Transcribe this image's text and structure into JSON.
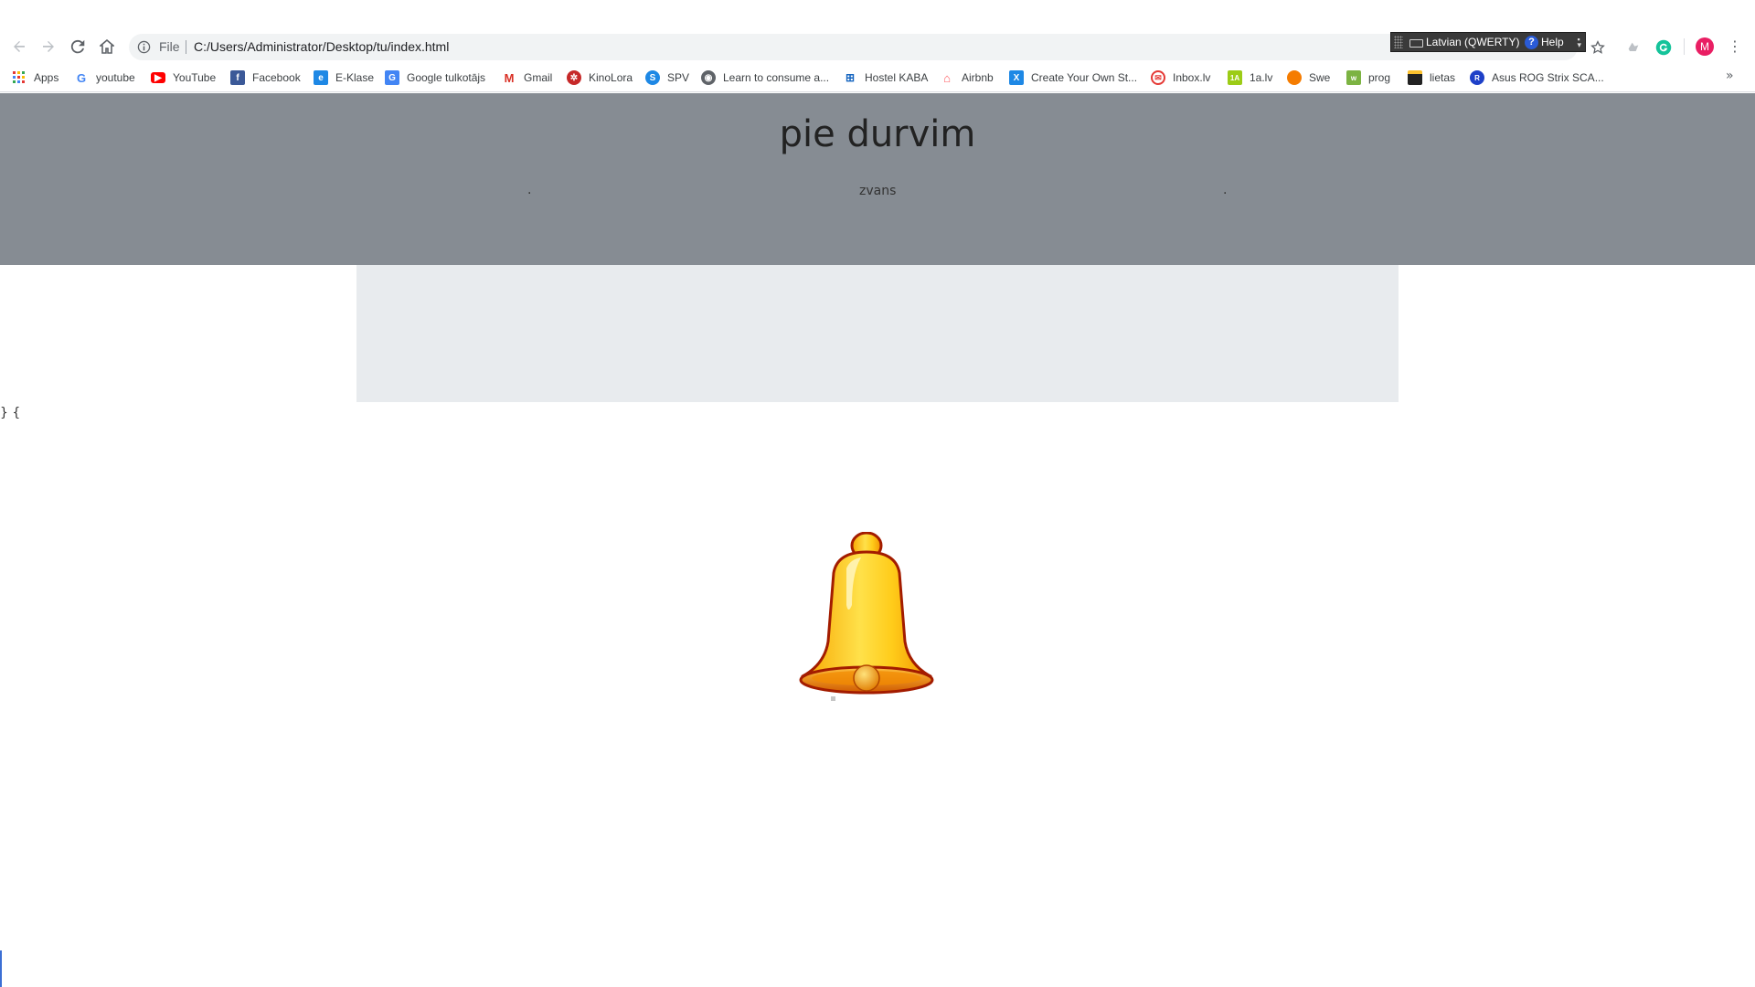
{
  "browser": {
    "address_prefix": "File",
    "url": "C:/Users/Administrator/Desktop/tu/index.html",
    "language_bar": {
      "language": "Latvian (QWERTY)",
      "help": "Help"
    },
    "avatar_letter": "M"
  },
  "bookmarks": [
    {
      "label": "Apps",
      "icon": "apps-grid-icon",
      "color": "#e53935"
    },
    {
      "label": "youtube",
      "icon": "google-icon",
      "color": "#4285f4"
    },
    {
      "label": "YouTube",
      "icon": "youtube-icon",
      "color": "#ff0000"
    },
    {
      "label": "Facebook",
      "icon": "facebook-icon",
      "color": "#3b5998"
    },
    {
      "label": "E-Klase",
      "icon": "eklase-icon",
      "color": "#1e88e5"
    },
    {
      "label": "Google tulkotājs",
      "icon": "google-translate-icon",
      "color": "#4285f4"
    },
    {
      "label": "Gmail",
      "icon": "gmail-icon",
      "color": "#d93025"
    },
    {
      "label": "KinoLora",
      "icon": "kinolora-icon",
      "color": "#c62828"
    },
    {
      "label": "SPV",
      "icon": "spv-icon",
      "color": "#1e88e5"
    },
    {
      "label": "Learn to consume a...",
      "icon": "globe-icon",
      "color": "#5f6368"
    },
    {
      "label": "Hostel KABA",
      "icon": "hostel-icon",
      "color": "#1565c0"
    },
    {
      "label": "Airbnb",
      "icon": "airbnb-icon",
      "color": "#ff5a5f"
    },
    {
      "label": "Create Your Own St...",
      "icon": "create-icon",
      "color": "#1e88e5"
    },
    {
      "label": "Inbox.lv",
      "icon": "inbox-icon",
      "color": "#e53935"
    },
    {
      "label": "1a.lv",
      "icon": "1a-icon",
      "color": "#9ccc16"
    },
    {
      "label": "Swe",
      "icon": "swe-icon",
      "color": "#f57c00"
    },
    {
      "label": "prog",
      "icon": "prog-icon",
      "color": "#7cb342"
    },
    {
      "label": "lietas",
      "icon": "lietas-icon",
      "color": "#222222"
    },
    {
      "label": "Asus ROG Strix SCA...",
      "icon": "asus-icon",
      "color": "#1e40c8"
    }
  ],
  "page": {
    "title": "pie durvim",
    "nav": {
      "left_dot": ".",
      "link": "zvans",
      "right_dot": "."
    },
    "stray_text": "} {",
    "colors": {
      "header_bg": "#868c93",
      "panel_bg": "#e8ebee"
    }
  }
}
